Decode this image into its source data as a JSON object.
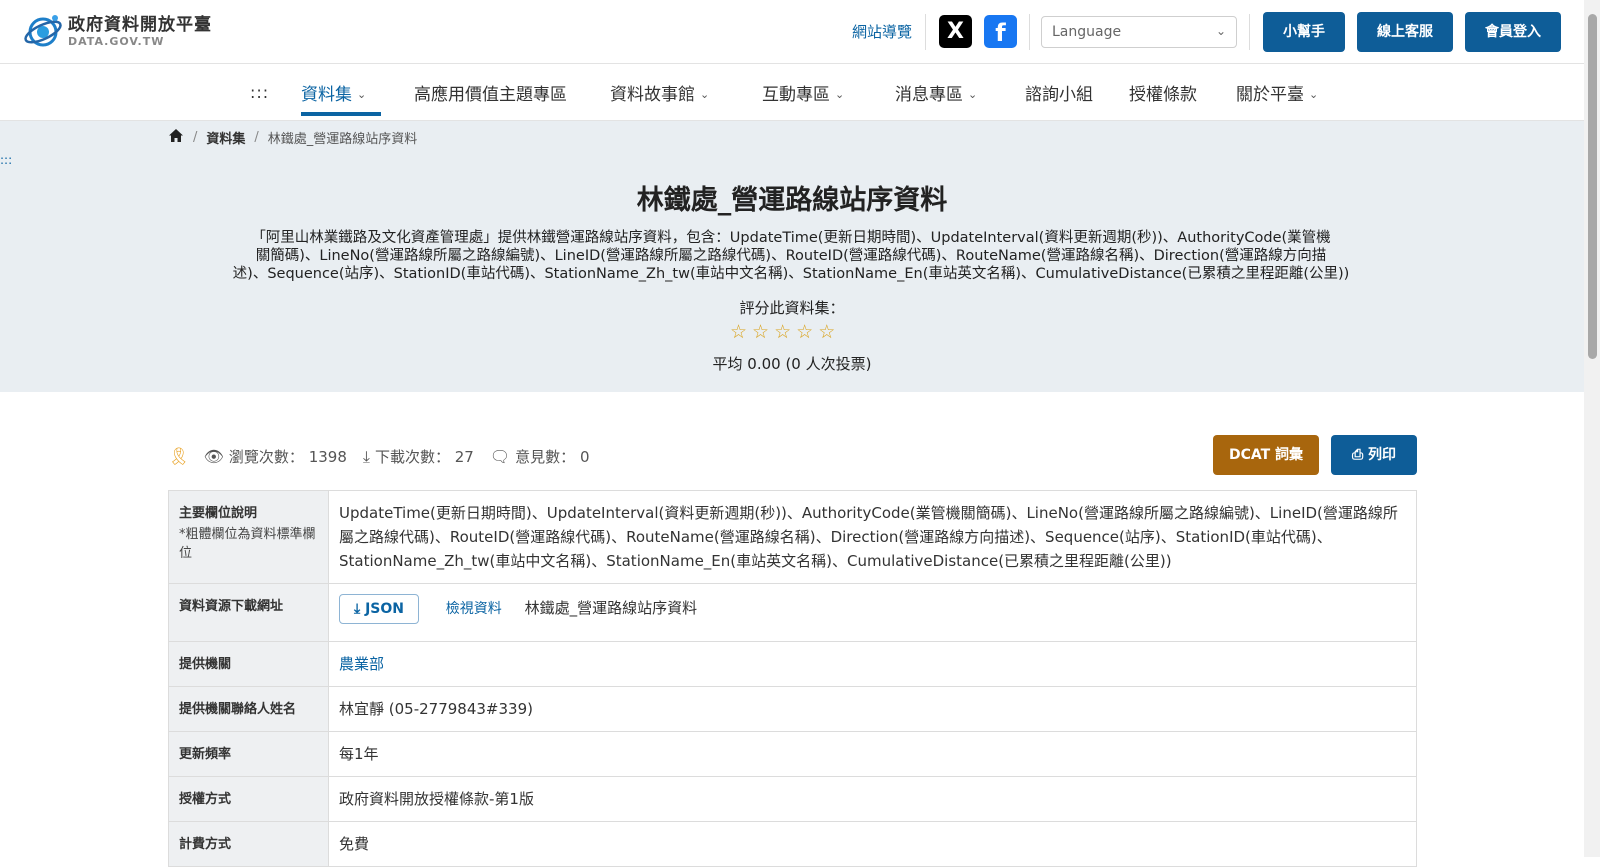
{
  "header": {
    "logo_title": "政府資料開放平臺",
    "logo_sub": "DATA.GOV.TW",
    "sitemap": "網站導覽",
    "social_x": "X",
    "social_fb": "f",
    "language_placeholder": "Language",
    "buttons": {
      "helper": "小幫手",
      "service": "線上客服",
      "login": "會員登入"
    }
  },
  "nav": {
    "skip": ":::",
    "items": [
      {
        "label": "資料集",
        "dropdown": true,
        "active": true
      },
      {
        "label": "高應用價值主題專區",
        "dropdown": false
      },
      {
        "label": "資料故事館",
        "dropdown": true
      },
      {
        "label": "互動專區",
        "dropdown": true
      },
      {
        "label": "消息專區",
        "dropdown": true
      },
      {
        "label": "諮詢小組",
        "dropdown": false
      },
      {
        "label": "授權條款",
        "dropdown": false
      },
      {
        "label": "關於平臺",
        "dropdown": true
      }
    ]
  },
  "breadcrumb": {
    "level1": "資料集",
    "current": "林鐵處_營運路線站序資料"
  },
  "side_skip": ":::",
  "dataset": {
    "title": "林鐵處_營運路線站序資料",
    "description_lines": [
      "「阿里山林業鐵路及文化資產管理處」提供林鐵營運路線站序資料，包含：UpdateTime(更新日期時間)、UpdateInterval(資料更新週期(秒))、AuthorityCode(業管機",
      "關簡碼)、LineNo(營運路線所屬之路線編號)、LineID(營運路線所屬之路線代碼)、RouteID(營運路線代碼)、RouteName(營運路線名稱)、Direction(營運路線方向描",
      "述)、Sequence(站序)、StationID(車站代碼)、StationName_Zh_tw(車站中文名稱)、StationName_En(車站英文名稱)、CumulativeDistance(已累積之里程距離(公里))"
    ],
    "rating_label": "評分此資料集：",
    "rating_stars": 0,
    "rating_avg": "平均 0.00 (0 人次投票)"
  },
  "stats": {
    "views_label": "瀏覽次數：",
    "views": "1398",
    "downloads_label": "下載次數：",
    "downloads": "27",
    "comments_label": "意見數：",
    "comments": "0"
  },
  "actions": {
    "dcat": "DCAT 詞彙",
    "print": "列印"
  },
  "table": {
    "fields_label": "主要欄位說明",
    "fields_note": "*粗體欄位為資料標準欄位",
    "fields_value": "UpdateTime(更新日期時間)、UpdateInterval(資料更新週期(秒))、AuthorityCode(業管機關簡碼)、LineNo(營運路線所屬之路線編號)、LineID(營運路線所屬之路線代碼)、RouteID(營運路線代碼)、RouteName(營運路線名稱)、Direction(營運路線方向描述)、Sequence(站序)、StationID(車站代碼)、StationName_Zh_tw(車站中文名稱)、StationName_En(車站英文名稱)、CumulativeDistance(已累積之里程距離(公里))",
    "download_label": "資料資源下載網址",
    "download_format": "JSON",
    "download_view": "檢視資料",
    "download_name": "林鐵處_營運路線站序資料",
    "agency_label": "提供機關",
    "agency": "農業部",
    "contact_label": "提供機關聯絡人姓名",
    "contact": "林宜靜 (05-2779843#339)",
    "frequency_label": "更新頻率",
    "frequency": "每1年",
    "license_label": "授權方式",
    "license": "政府資料開放授權條款-第1版",
    "fee_label": "計費方式",
    "fee": "免費"
  }
}
